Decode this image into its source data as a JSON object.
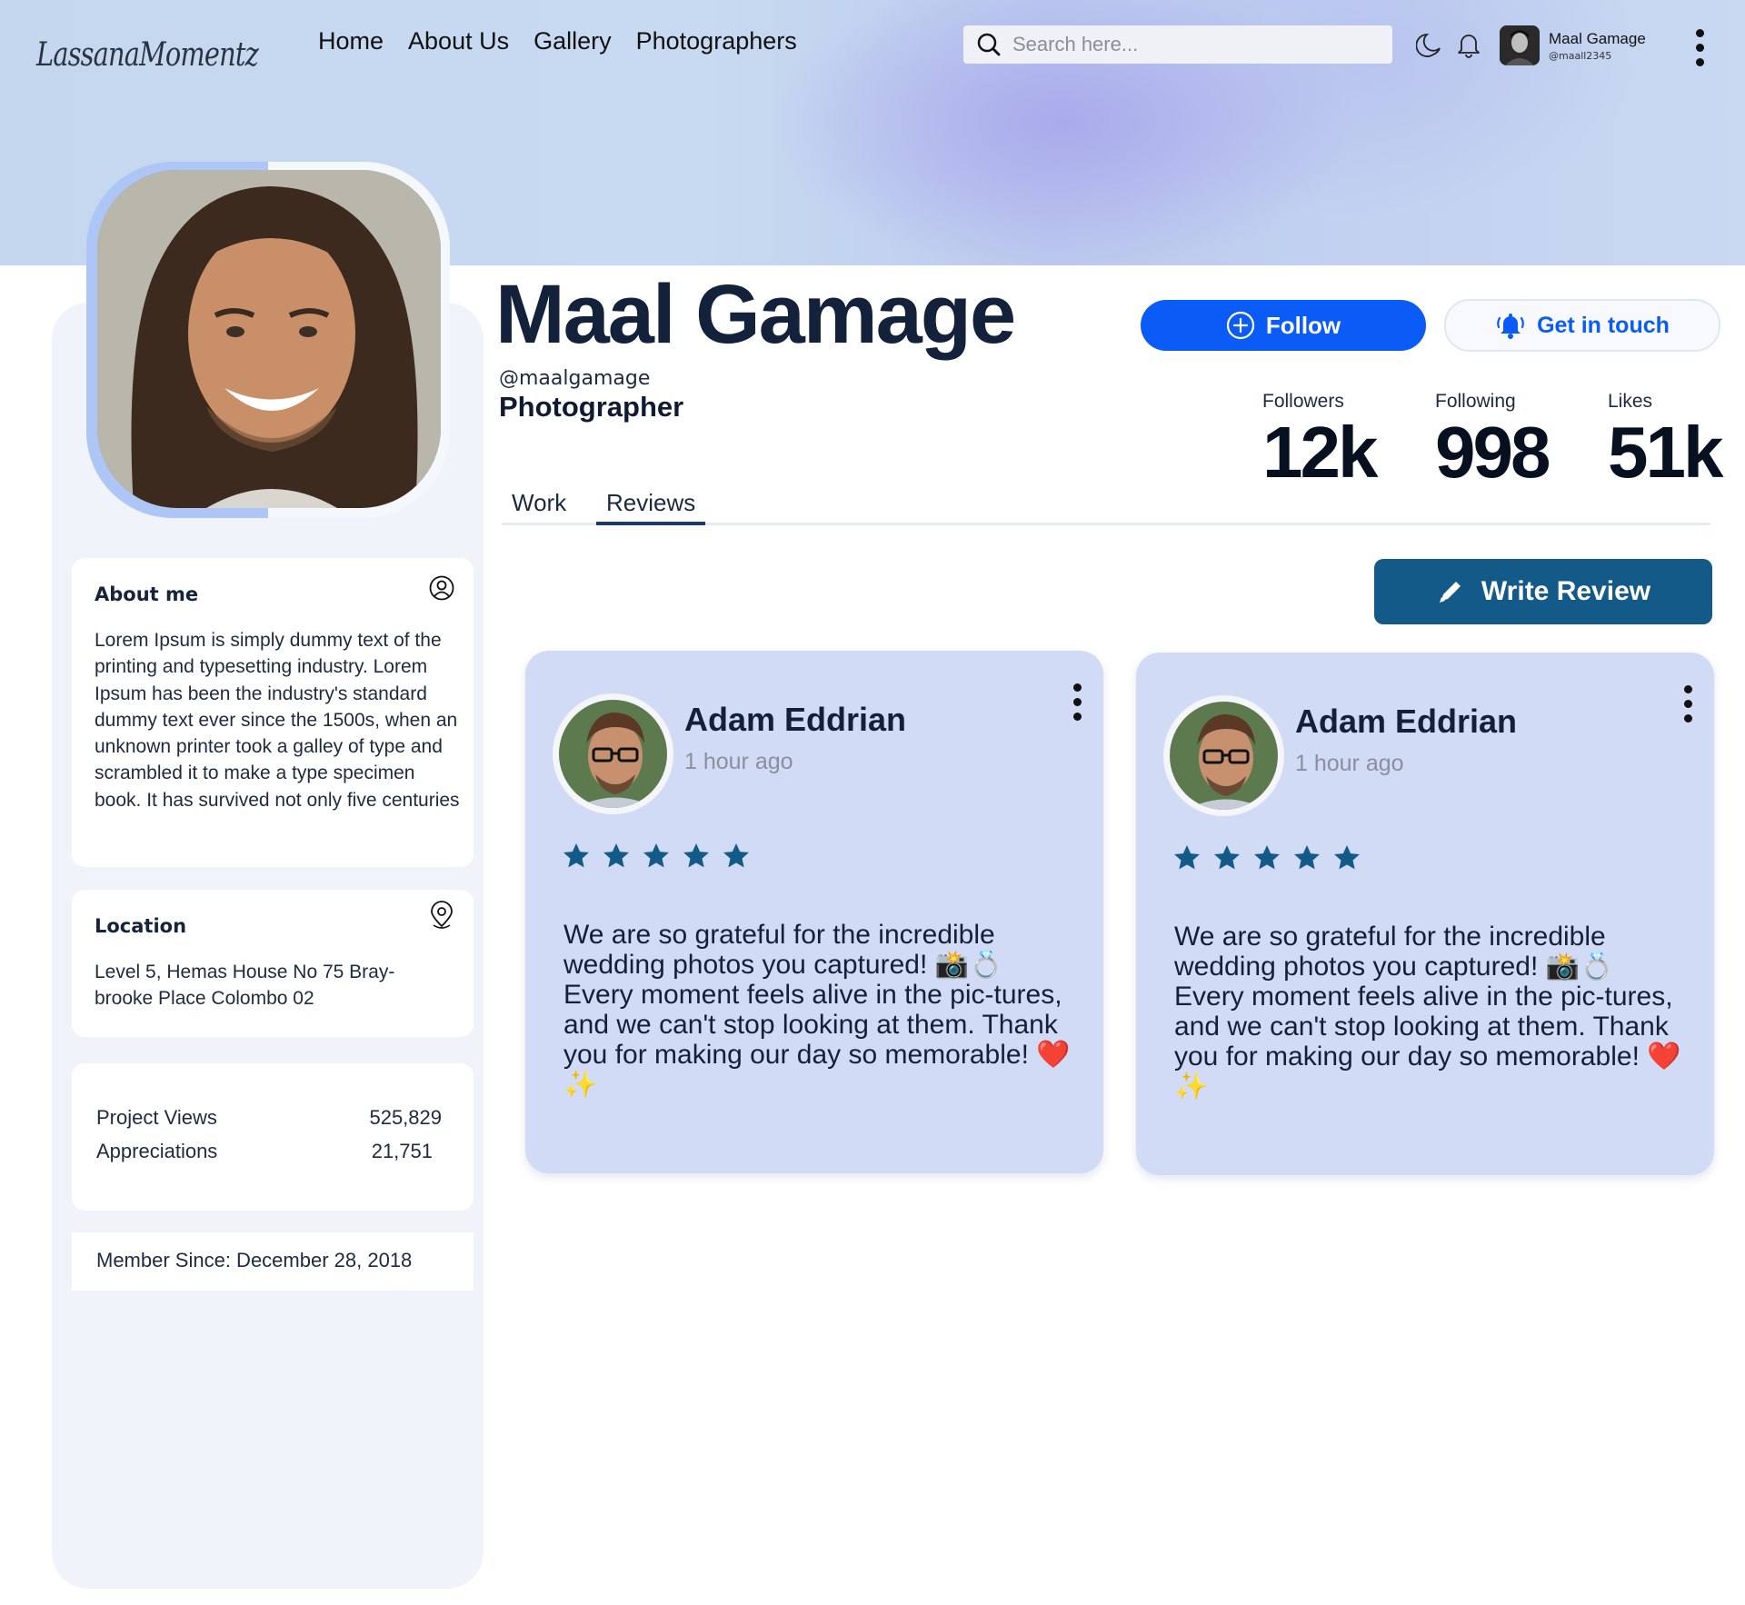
{
  "header": {
    "logo_text": "LassanaMomentz",
    "nav": [
      "Home",
      "About Us",
      "Gallery",
      "Photographers"
    ],
    "search_placeholder": "Search here...",
    "user_name": "Maal Gamage",
    "user_handle": "@maall2345"
  },
  "profile": {
    "name": "Maal Gamage",
    "handle": "@maalgamage",
    "role": "Photographer",
    "follow_label": "Follow",
    "contact_label": "Get in touch",
    "stats": [
      {
        "label": "Followers",
        "value": "12k"
      },
      {
        "label": "Following",
        "value": "998"
      },
      {
        "label": "Likes",
        "value": "51k"
      }
    ]
  },
  "sidebar": {
    "about_title": "About me",
    "about_text": "Lorem Ipsum is simply dummy text of the printing and typesetting industry. Lorem Ipsum has been the industry's standard dummy text ever since the 1500s, when an unknown printer took a galley of type and scrambled it to make a type specimen book. It has survived not only five centuries",
    "location_title": "Location",
    "location_text": "Level 5, Hemas House No 75 Bray-brooke Place Colombo 02",
    "metrics": [
      {
        "label": "Project Views",
        "value": "525,829"
      },
      {
        "label": "Appreciations",
        "value": "21,751"
      }
    ],
    "member_since": "Member Since: December 28, 2018"
  },
  "tabs": [
    {
      "label": "Work",
      "active": false
    },
    {
      "label": "Reviews",
      "active": true
    }
  ],
  "write_review_label": "Write Review",
  "reviews": [
    {
      "author": "Adam Eddrian",
      "time": "1 hour ago",
      "rating": 5,
      "text": "We are so grateful for the incredible wedding photos you captured! 📸💍 Every moment feels alive in the pic-tures, and we can't stop looking at them. Thank you for making our day so memorable! ❤️✨"
    },
    {
      "author": "Adam Eddrian",
      "time": "1 hour ago",
      "rating": 5,
      "text": "We are so grateful for the incredible wedding photos you captured! 📸💍 Every moment feels alive in the pic-tures, and we can't stop looking at them. Thank you for making our day so memorable! ❤️✨"
    }
  ],
  "colors": {
    "primary": "#0b5cf6",
    "review_button": "#145a89",
    "review_card": "#d2dbf5",
    "star": "#145a89",
    "heading": "#14213b"
  }
}
